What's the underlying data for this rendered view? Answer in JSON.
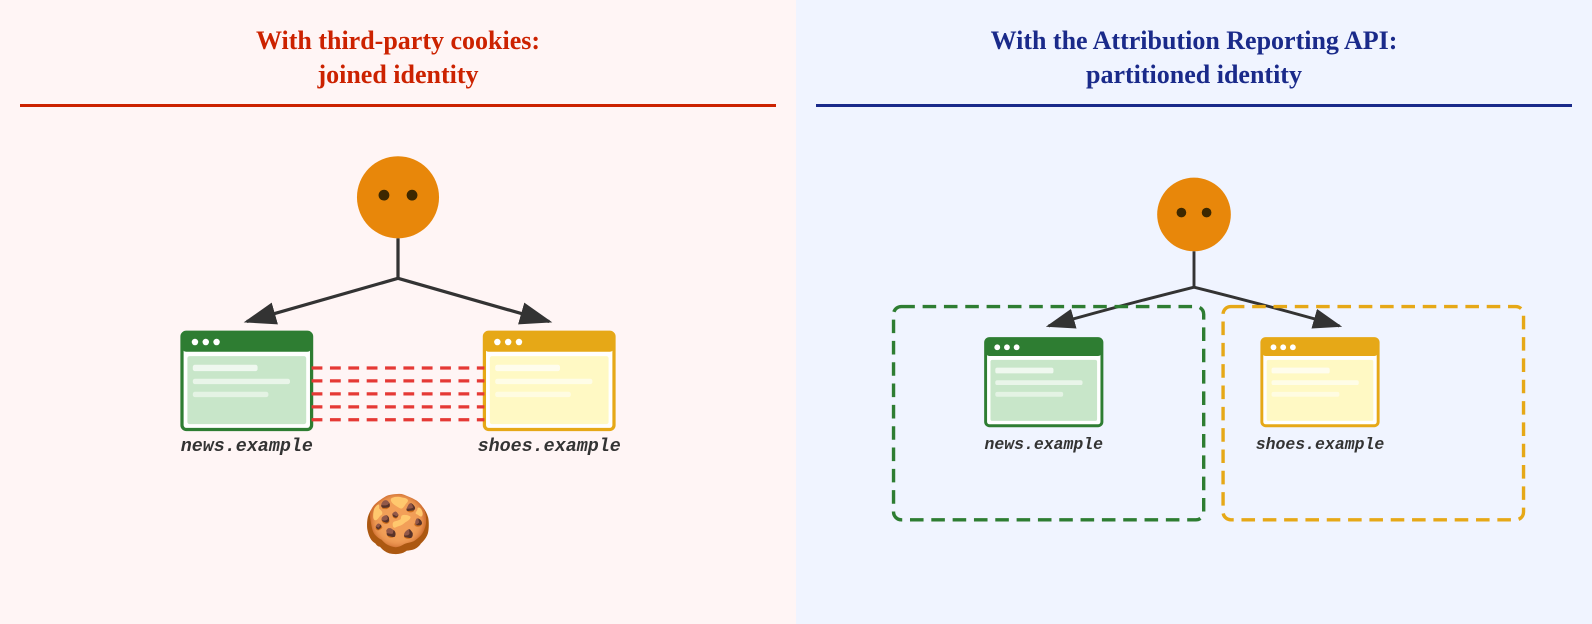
{
  "left": {
    "title_line1": "With third-party cookies:",
    "title_line2": "joined identity",
    "label_news": "news.example",
    "label_shoes": "shoes.example"
  },
  "right": {
    "title_line1": "With the Attribution Reporting API:",
    "title_line2": "partitioned identity",
    "label_news": "news.example",
    "label_shoes": "shoes.example"
  }
}
